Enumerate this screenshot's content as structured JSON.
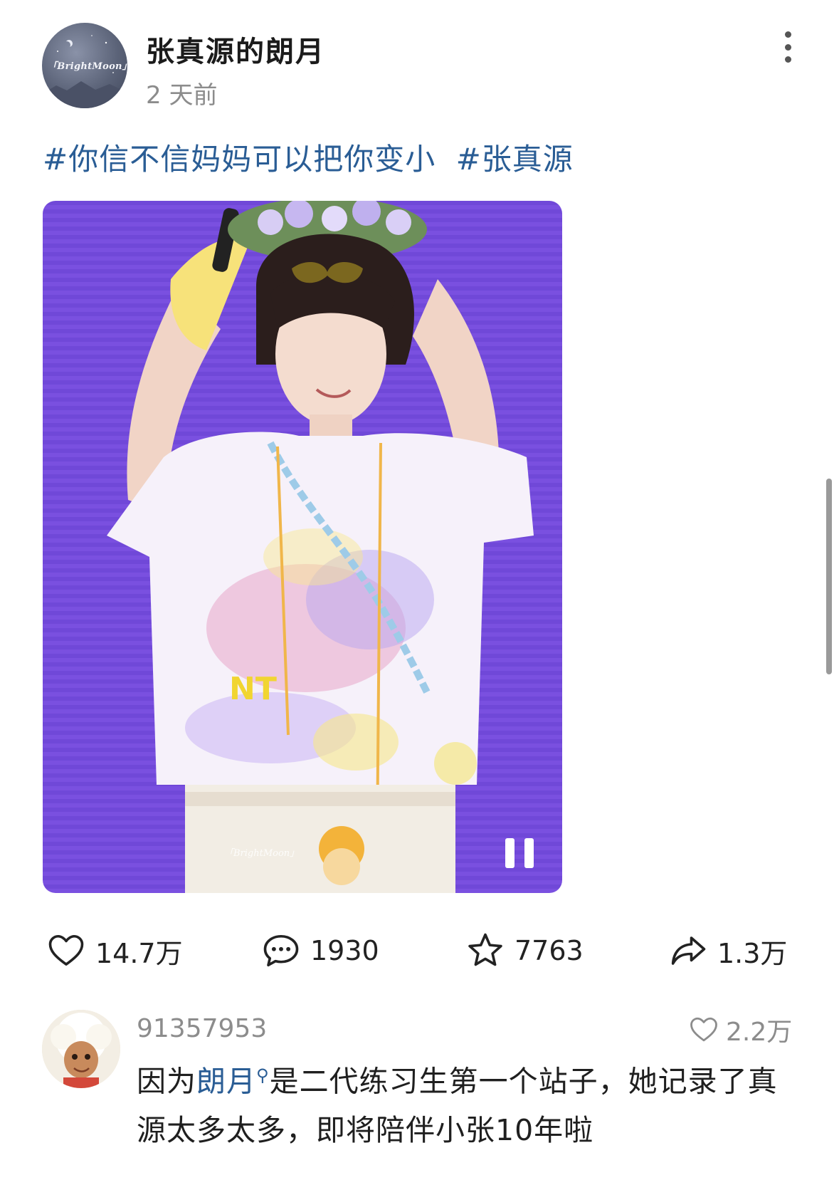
{
  "post": {
    "author": "张真源的朗月",
    "time": "2 天前",
    "avatar_text": "「BrightMoon」",
    "hashtags": [
      "#你信不信妈妈可以把你变小",
      "#张真源"
    ],
    "media_watermark": "「BrightMoon」"
  },
  "actions": {
    "like_count": "14.7万",
    "comment_count": "1930",
    "favorite_count": "7763",
    "share_count": "1.3万"
  },
  "comment": {
    "user": "91357953",
    "like_count": "2.2万",
    "text_before": "因为",
    "mention": "朗月",
    "text_after": "是二代练习生第一个站子，她记录了真源太多太多，即将陪伴小张10年啦"
  },
  "colors": {
    "link": "#2a5d95",
    "media_background": "#7a50e0",
    "muted_text": "#8c8c8c"
  },
  "icons": [
    "more-vertical-icon",
    "heart-icon",
    "comment-bubble-icon",
    "star-icon",
    "share-arrow-icon",
    "pause-icon",
    "search-mention-icon"
  ]
}
